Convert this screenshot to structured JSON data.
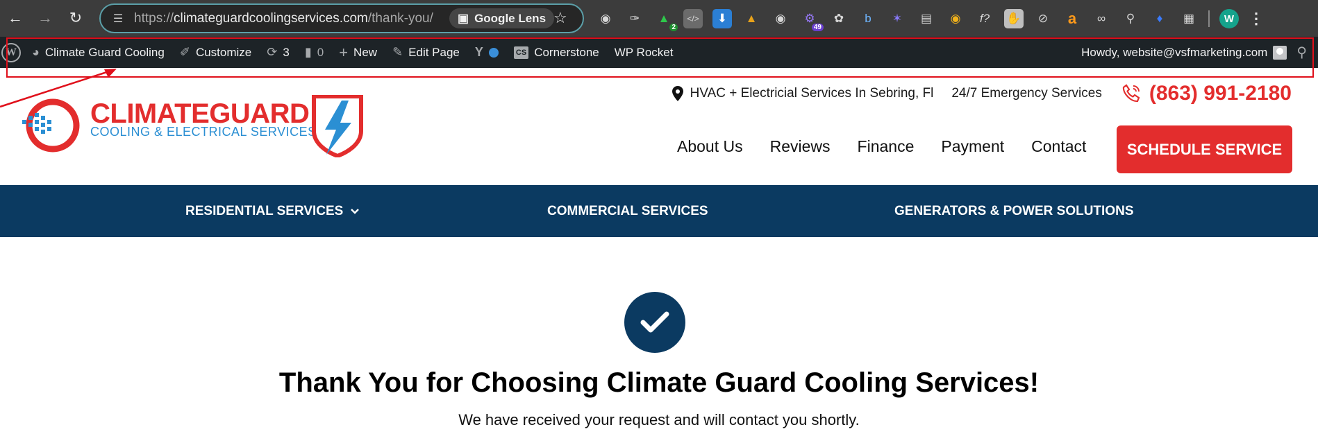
{
  "browser": {
    "url_prefix": "https://",
    "url_domain": "climateguardcoolingservices.com",
    "url_path": "/thank-you/",
    "lens_label": "Google Lens",
    "extension_badges": {
      "ext2": "2",
      "ext13": "49"
    },
    "profile_initial": "W",
    "accent": "#5b9fa8"
  },
  "adminbar": {
    "site_name": "Climate Guard Cooling",
    "customize": "Customize",
    "updates_count": "3",
    "comments_count": "0",
    "new_label": "New",
    "edit_page": "Edit Page",
    "cs_badge": "CS",
    "cornerstone": "Cornerstone",
    "wp_rocket": "WP Rocket",
    "howdy": "Howdy, website@vsfmarketing.com"
  },
  "header": {
    "logo_word": "CLIMATEGUARD",
    "logo_sub": "COOLING & ELECTRICAL SERVICES",
    "location": "HVAC + Electricial Services In Sebring, Fl",
    "emergency": "24/7 Emergency Services",
    "phone": "(863) 991-2180",
    "nav": [
      "About Us",
      "Reviews",
      "Finance",
      "Payment",
      "Contact"
    ],
    "cta": "SCHEDULE SERVICE",
    "brand_red": "#e32d2d",
    "brand_navy": "#0b3a61"
  },
  "secondary_nav": {
    "residential": "RESIDENTIAL SERVICES",
    "commercial": "COMMERCIAL SERVICES",
    "generators": "GENERATORS & POWER SOLUTIONS"
  },
  "hero": {
    "title": "Thank You for Choosing Climate Guard Cooling Services!",
    "subtitle": "We have received your request and will contact you shortly."
  }
}
